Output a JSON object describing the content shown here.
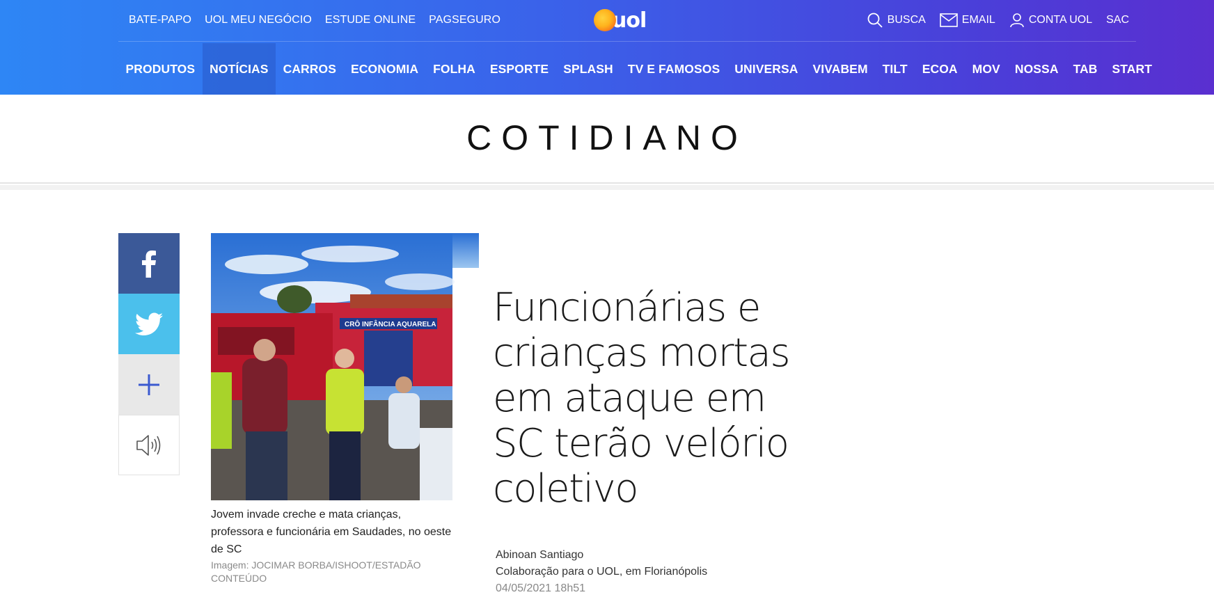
{
  "header": {
    "top_links": [
      "BATE-PAPO",
      "UOL MEU NEGÓCIO",
      "ESTUDE ONLINE",
      "PAGSEGURO"
    ],
    "logo_text": "uol",
    "tools": {
      "search": "BUSCA",
      "email": "EMAIL",
      "account": "CONTA UOL",
      "sac": "SAC"
    },
    "nav": [
      "PRODUTOS",
      "NOTÍCIAS",
      "CARROS",
      "ECONOMIA",
      "FOLHA",
      "ESPORTE",
      "SPLASH",
      "TV E FAMOSOS",
      "UNIVERSA",
      "VIVABEM",
      "TILT",
      "ECOA",
      "MOV",
      "NOSSA",
      "TAB",
      "START"
    ],
    "active_nav": "NOTÍCIAS"
  },
  "section": {
    "title": "COTIDIANO"
  },
  "share": {
    "icons": [
      "facebook-icon",
      "twitter-icon",
      "plus-icon",
      "speaker-icon"
    ],
    "colors": {
      "facebook": "#3b5998",
      "twitter": "#4bc0ec",
      "more": "#e8e8e8"
    }
  },
  "article": {
    "image_sign": "CRÔ INFÂNCIA AQUARELA",
    "caption": "Jovem invade creche e mata crianças, professora e funcionária em Saudades, no oeste de SC",
    "credit": "Imagem: JOCIMAR BORBA/ISHOOT/ESTADÃO CONTEÚDO",
    "headline": "Funcionárias e crianças mortas em ataque em SC terão velório coletivo",
    "author": "Abinoan Santiago",
    "org": "Colaboração para o UOL, em Florianópolis",
    "date": "04/05/2021  18h51"
  }
}
